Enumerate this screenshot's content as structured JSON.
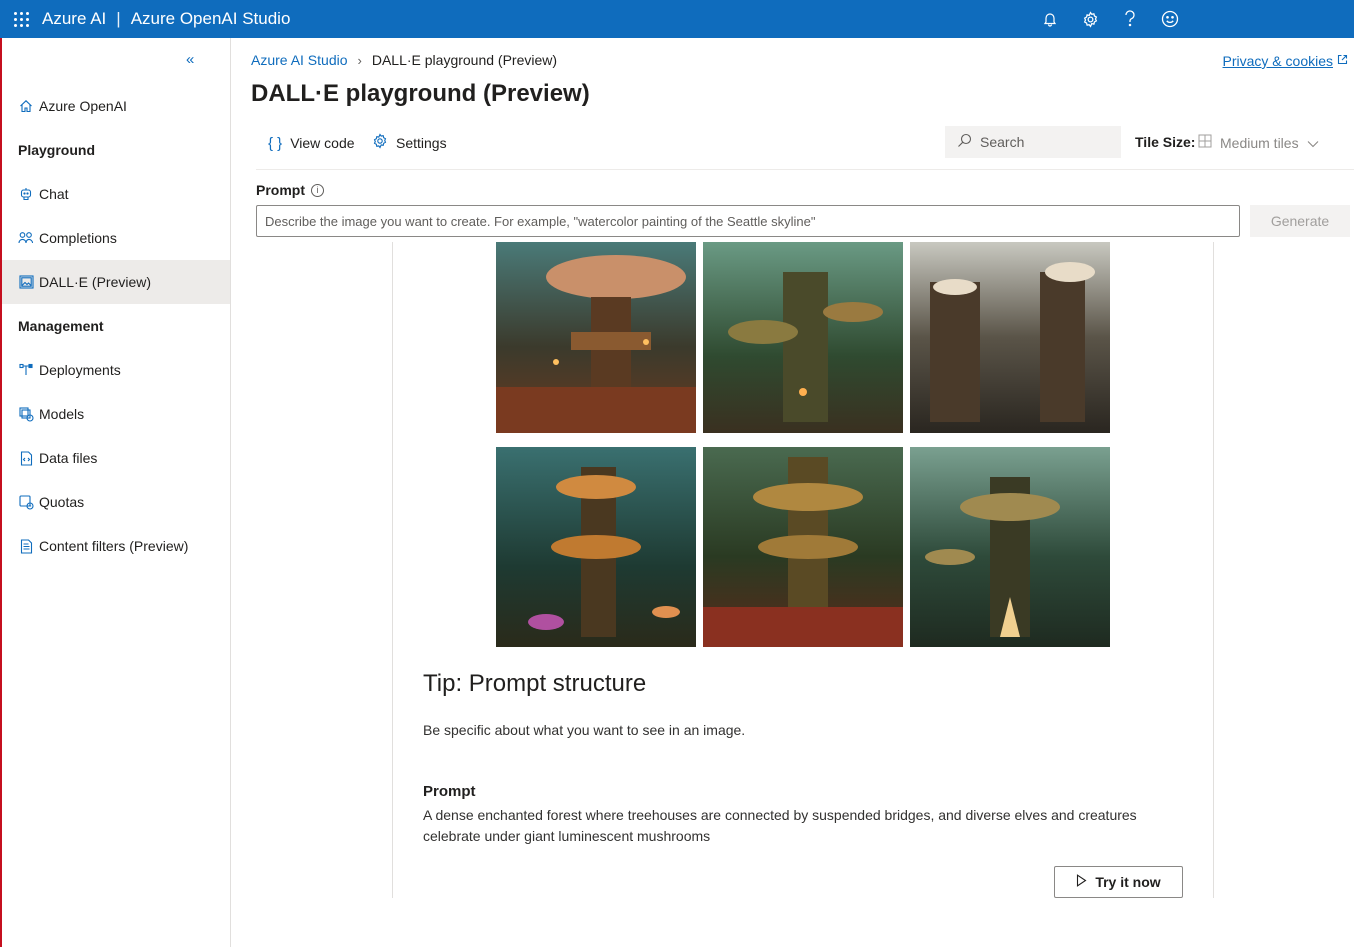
{
  "header": {
    "brand": "Azure AI",
    "separator": "|",
    "product": "Azure OpenAI Studio",
    "icons": [
      "bell-icon",
      "gear-icon",
      "help-icon",
      "feedback-smiley-icon"
    ]
  },
  "sidebar": {
    "collapse_icon": "double-chevron-left-icon",
    "items": [
      {
        "type": "item",
        "label": "Azure OpenAI",
        "icon": "home-icon"
      },
      {
        "type": "heading",
        "label": "Playground"
      },
      {
        "type": "item",
        "label": "Chat",
        "icon": "chat-icon"
      },
      {
        "type": "item",
        "label": "Completions",
        "icon": "completions-icon"
      },
      {
        "type": "item",
        "label": "DALL·E (Preview)",
        "icon": "image-icon",
        "active": true
      },
      {
        "type": "heading",
        "label": "Management"
      },
      {
        "type": "item",
        "label": "Deployments",
        "icon": "deployments-icon"
      },
      {
        "type": "item",
        "label": "Models",
        "icon": "models-icon"
      },
      {
        "type": "item",
        "label": "Data files",
        "icon": "data-files-icon"
      },
      {
        "type": "item",
        "label": "Quotas",
        "icon": "quotas-icon"
      },
      {
        "type": "item",
        "label": "Content filters (Preview)",
        "icon": "content-filters-icon"
      }
    ]
  },
  "breadcrumb": {
    "root": "Azure AI Studio",
    "current": "DALL·E playground (Preview)"
  },
  "privacy_link": "Privacy & cookies",
  "page_title": "DALL·E playground (Preview)",
  "toolbar": {
    "view_code": "View code",
    "settings": "Settings",
    "search_placeholder": "Search",
    "tile_size_label": "Tile Size:",
    "tile_size_value": "Medium tiles"
  },
  "prompt": {
    "label": "Prompt",
    "placeholder": "Describe the image you want to create. For example, \"watercolor painting of the Seattle skyline\"",
    "generate_label": "Generate"
  },
  "tip": {
    "title": "Tip: Prompt structure",
    "text": "Be specific about what you want to see in an image.",
    "example_label": "Prompt",
    "example_text": "A dense enchanted forest where treehouses are connected by suspended bridges, and diverse elves and creatures celebrate under giant luminescent mushrooms",
    "button": "Try it now"
  },
  "colors": {
    "header_bg": "#0f6cbd",
    "accent": "#0f6cbd",
    "active_nav_bg": "#edebe9"
  }
}
